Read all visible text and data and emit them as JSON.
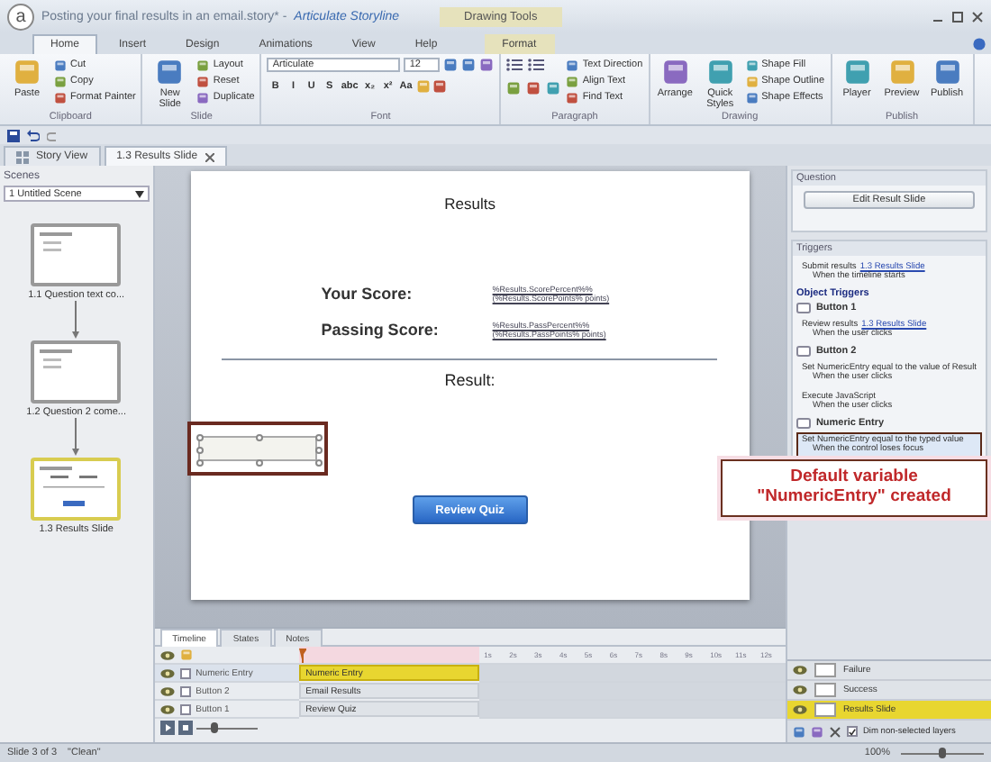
{
  "window": {
    "logo": "a",
    "title": "Posting your final results in an email.story* -",
    "app_name": "Articulate Storyline",
    "context_group": "Drawing Tools"
  },
  "ribbon_tabs": [
    {
      "label": "Home",
      "selected": true,
      "kind": "standard"
    },
    {
      "label": "Insert",
      "selected": false,
      "kind": "standard"
    },
    {
      "label": "Design",
      "selected": false,
      "kind": "standard"
    },
    {
      "label": "Animations",
      "selected": false,
      "kind": "standard"
    },
    {
      "label": "View",
      "selected": false,
      "kind": "standard"
    },
    {
      "label": "Help",
      "selected": false,
      "kind": "standard"
    },
    {
      "label": "Format",
      "selected": false,
      "kind": "contextual"
    }
  ],
  "ribbon_groups": [
    {
      "title": "Clipboard",
      "kind": "commands",
      "large": [
        "Paste"
      ],
      "small": [
        "Cut",
        "Copy",
        "Format Painter"
      ]
    },
    {
      "title": "Slide",
      "kind": "commands",
      "large": [
        "New Slide"
      ],
      "small": [
        "Layout",
        "Reset",
        "Duplicate"
      ]
    },
    {
      "title": "Font",
      "kind": "font",
      "font": "Articulate",
      "size": "12",
      "format_buttons": [
        "B",
        "I",
        "U",
        "S",
        "abc",
        "x₂",
        "x²",
        "Aa"
      ]
    },
    {
      "title": "Paragraph",
      "kind": "paragraph",
      "small": [
        "Text Direction",
        "Align Text",
        "Find Text"
      ]
    },
    {
      "title": "Drawing",
      "kind": "commands",
      "large": [
        "Arrange",
        "Quick Styles"
      ],
      "small": [
        "Shape Fill",
        "Shape Outline",
        "Shape Effects"
      ]
    },
    {
      "title": "Publish",
      "kind": "commands",
      "large": [
        "Player",
        "Preview",
        "Publish"
      ]
    }
  ],
  "doc_tabs": [
    {
      "label": "Story View",
      "selected": false
    },
    {
      "label": "1.3 Results Slide",
      "selected": true
    }
  ],
  "scenes": {
    "title": "Scenes",
    "scene": "1 Untitled Scene",
    "slides": [
      {
        "label": "1.1 Question text co...",
        "selected": false
      },
      {
        "label": "1.2 Question 2 come...",
        "selected": false
      },
      {
        "label": "1.3 Results Slide",
        "selected": true
      }
    ]
  },
  "slide": {
    "title": "Results",
    "rows": [
      {
        "label": "Your Score:",
        "value": "%Results.ScorePercent%% (%Results.ScorePoints% points)"
      },
      {
        "label": "Passing Score:",
        "value": "%Results.PassPercent%% (%Results.PassPoints% points)"
      }
    ],
    "result_label": "Result:",
    "button": "Review Quiz"
  },
  "timeline": {
    "tabs": [
      {
        "label": "Timeline",
        "selected": true
      },
      {
        "label": "States",
        "selected": false
      },
      {
        "label": "Notes",
        "selected": false
      }
    ],
    "zoom": {
      "level": 0.3
    },
    "ticks": [
      "1s",
      "2s",
      "3s",
      "4s",
      "5s",
      "6s",
      "7s",
      "8s",
      "9s",
      "10s",
      "11s",
      "12s"
    ],
    "rows": [
      {
        "name": "Numeric Entry",
        "bar": "Numeric Entry",
        "selected": true
      },
      {
        "name": "Button 2",
        "bar": "Email Results",
        "selected": false
      },
      {
        "name": "Button 1",
        "bar": "Review Quiz",
        "selected": false
      }
    ]
  },
  "question": {
    "title": "Question",
    "button": "Edit Result Slide"
  },
  "triggers": {
    "title": "Triggers",
    "items": [
      {
        "kind": "trigger",
        "action": "Submit results",
        "link": "1.3 Results Slide",
        "when": "When the timeline starts",
        "selected": false
      },
      {
        "kind": "heading",
        "label": "Object Triggers"
      },
      {
        "kind": "object",
        "label": "Button 1"
      },
      {
        "kind": "trigger",
        "action": "Review results",
        "link": "1.3 Results Slide",
        "when": "When the user clicks",
        "selected": false
      },
      {
        "kind": "object",
        "label": "Button 2"
      },
      {
        "kind": "trigger",
        "action": "Set NumericEntry equal to the value of Result",
        "when": "When the user clicks",
        "selected": false
      },
      {
        "kind": "trigger",
        "action": "Execute JavaScript",
        "when": "When the user clicks",
        "selected": false
      },
      {
        "kind": "object",
        "label": "Numeric Entry"
      },
      {
        "kind": "trigger",
        "action": "Set NumericEntry equal to the typed value",
        "when": "When the control loses focus",
        "selected": true
      }
    ]
  },
  "layers": {
    "items": [
      {
        "label": "Failure",
        "selected": false
      },
      {
        "label": "Success",
        "selected": false
      },
      {
        "label": "Results Slide",
        "selected": true
      }
    ],
    "dim_option": {
      "label": "Dim non-selected layers",
      "checked": true
    }
  },
  "callout": {
    "text": "Default variable \"NumericEntry\" created"
  },
  "status_bar": {
    "slide": "Slide 3 of 3",
    "theme": "\"Clean\"",
    "zoom": "100%",
    "zoom_slider": {
      "level": 0.5
    }
  }
}
